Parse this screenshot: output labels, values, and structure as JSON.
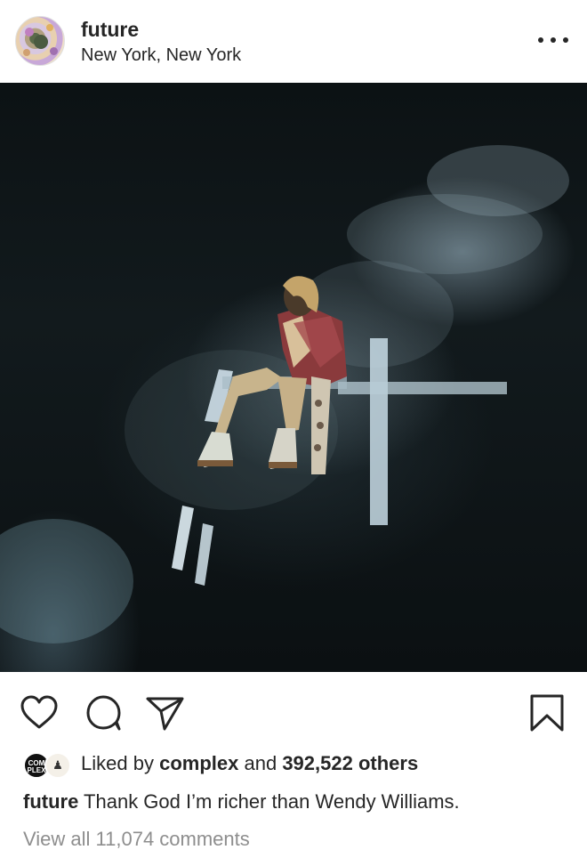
{
  "post": {
    "username": "future",
    "location": "New York, New York"
  },
  "likes": {
    "avatar1_text": "COM PLEX",
    "prefix": "Liked by",
    "liker": "complex",
    "and": "and",
    "count": "392,522 others"
  },
  "caption": {
    "username": "future",
    "text": "Thank God I’m richer than Wendy Williams."
  },
  "comments": {
    "label": "View all 11,074 comments"
  },
  "icons": {
    "more": "more-options-icon",
    "like": "heart-icon",
    "comment": "comment-icon",
    "share": "share-icon",
    "save": "bookmark-icon"
  }
}
